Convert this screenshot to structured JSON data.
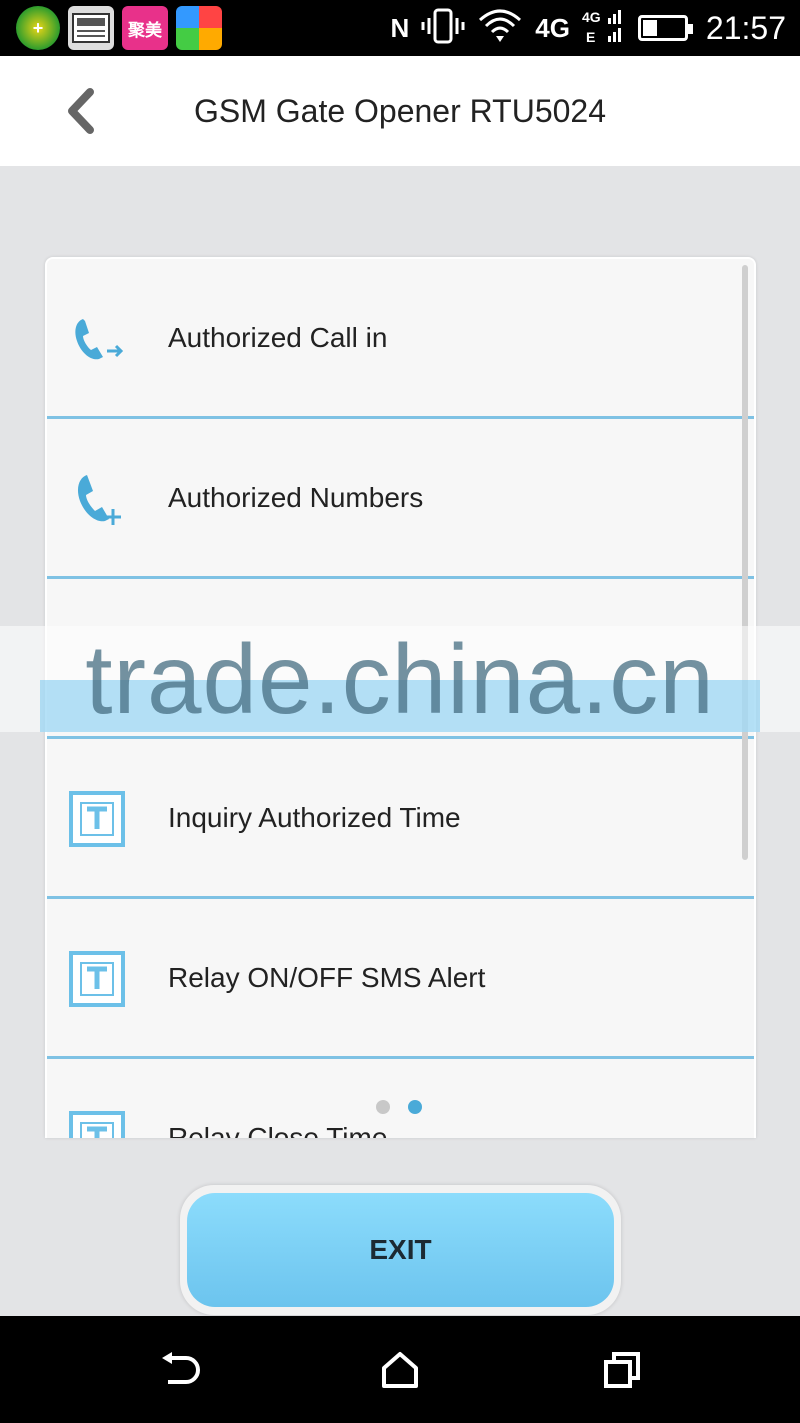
{
  "status_bar": {
    "app_icons": [
      {
        "name": "green-plus-app-icon",
        "glyph": "+"
      },
      {
        "name": "news-app-icon",
        "glyph": ""
      },
      {
        "name": "jumei-app-icon",
        "glyph": "聚美"
      },
      {
        "name": "multicolor-app-icon",
        "glyph": ""
      }
    ],
    "nfc": "N",
    "network_4g": "4G",
    "signal_text": "4G E",
    "battery_percent": 35,
    "time": "21:57"
  },
  "header": {
    "title": "GSM Gate Opener RTU5024",
    "back_icon": "chevron-left-icon"
  },
  "menu": {
    "items": [
      {
        "label": "Authorized Call in",
        "icon": "phone-arrow-icon"
      },
      {
        "label": "Authorized Numbers",
        "icon": "phone-plus-icon"
      },
      {
        "label": "",
        "icon": ""
      },
      {
        "label": "Inquiry Authorized Time",
        "icon": "t-box-icon"
      },
      {
        "label": "Relay ON/OFF SMS Alert",
        "icon": "t-box-icon"
      },
      {
        "label": "Relay Close Time",
        "icon": "t-box-icon"
      }
    ]
  },
  "pager": {
    "count": 2,
    "active_index": 1
  },
  "watermark": {
    "text": "trade.china.cn"
  },
  "exit_button": {
    "label": "EXIT"
  },
  "nav_bar": {
    "icons": [
      "back-icon",
      "home-icon",
      "recents-icon"
    ]
  },
  "colors": {
    "accent": "#4aaad8",
    "separator": "#7fc2e4",
    "exit_button": "#7ed0f6",
    "background": "#e3e4e6"
  }
}
